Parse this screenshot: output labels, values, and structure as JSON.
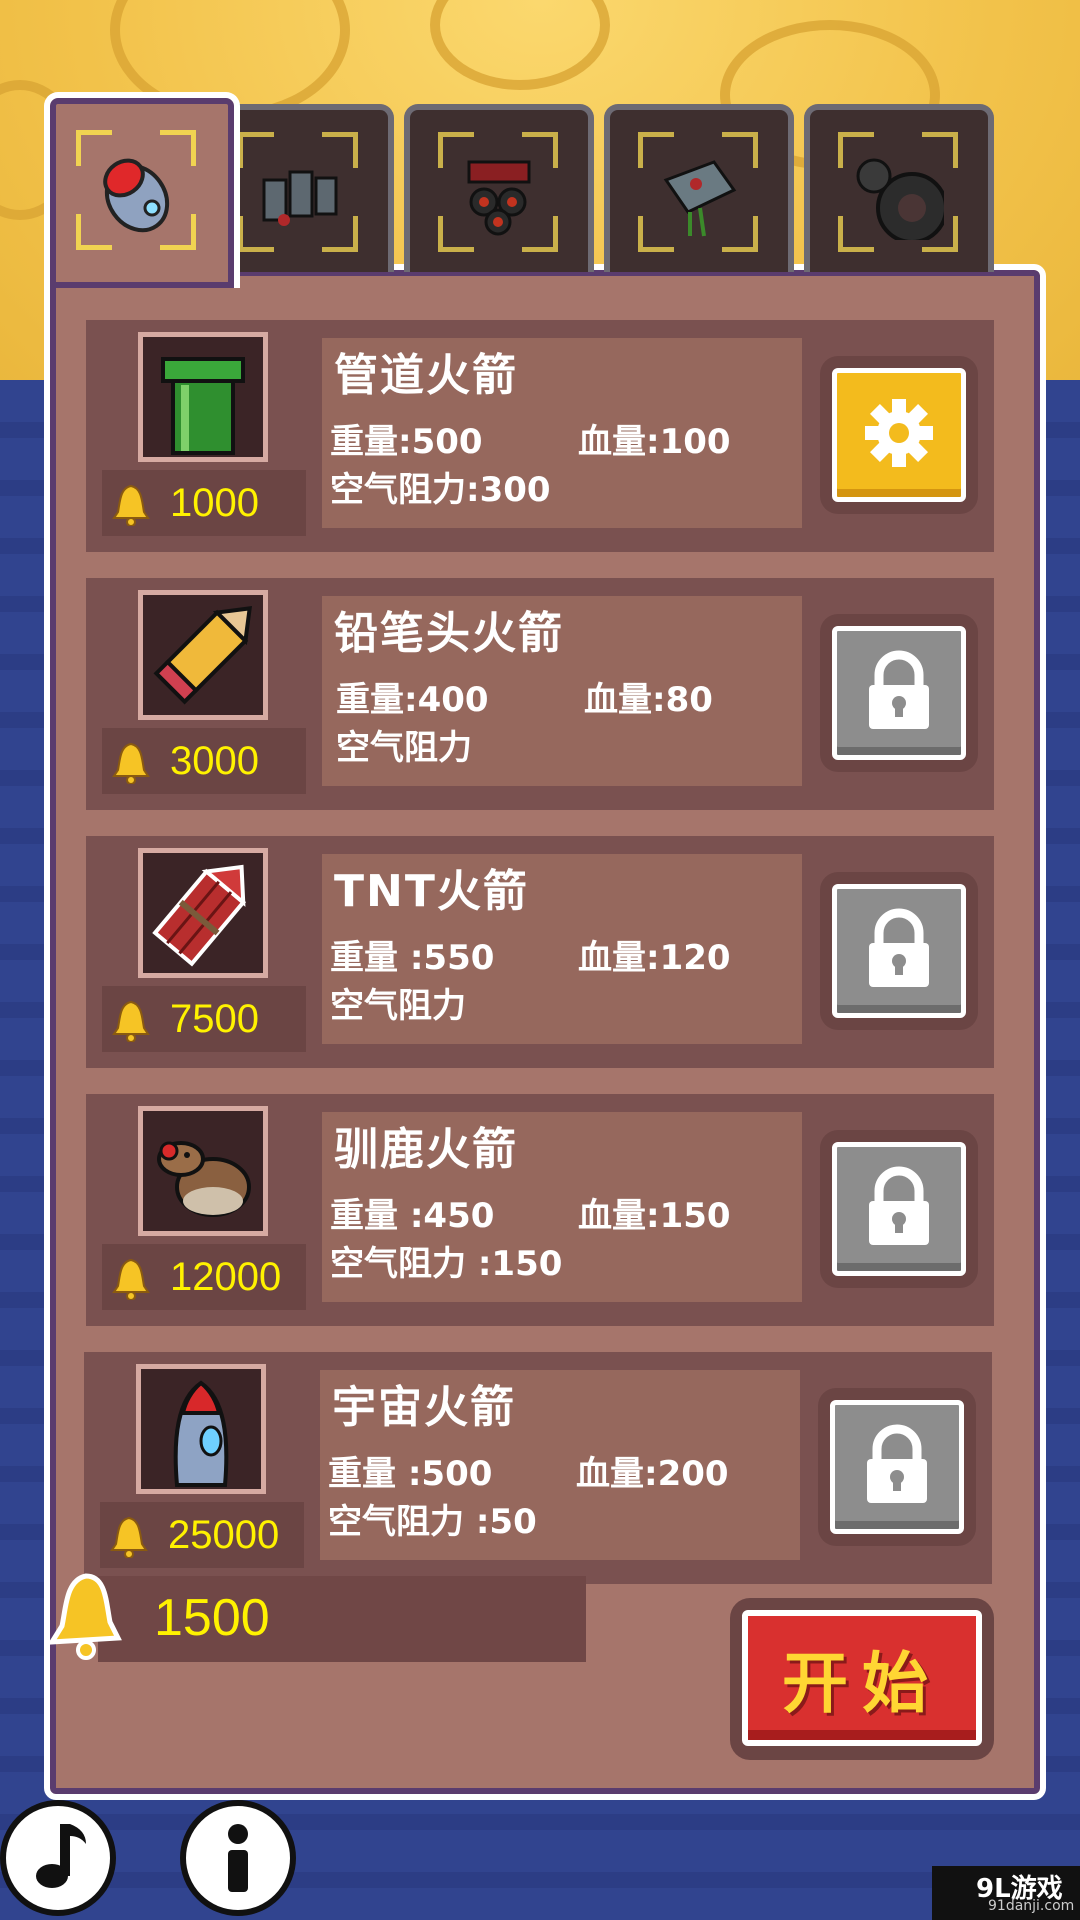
{
  "tabs": [
    {
      "name": "tab-rocket",
      "icon": "rocket-icon",
      "active": true
    },
    {
      "name": "tab-engine",
      "icon": "engine-icon",
      "active": false
    },
    {
      "name": "tab-thruster",
      "icon": "thruster-icon",
      "active": false
    },
    {
      "name": "tab-launcher",
      "icon": "launcher-icon",
      "active": false
    },
    {
      "name": "tab-gear",
      "icon": "cogwheel-icon",
      "active": false
    }
  ],
  "rockets": [
    {
      "name": "管道火箭",
      "weight": "重量:500",
      "hp": "血量:100",
      "drag": "空气阻力:300",
      "price": "1000",
      "icon": "pipe-rocket-icon",
      "action": "gear-icon"
    },
    {
      "name": "铅笔头火箭",
      "weight": "重量:400",
      "hp": "血量:80",
      "drag": "空气阻力",
      "price": "3000",
      "icon": "pencil-rocket-icon",
      "action": "lock-icon"
    },
    {
      "name": "TNT火箭",
      "weight": "重量 :550",
      "hp": "血量:120",
      "drag": "空气阻力",
      "price": "7500",
      "icon": "tnt-rocket-icon",
      "action": "lock-icon"
    },
    {
      "name": "驯鹿火箭",
      "weight": "重量 :450",
      "hp": "血量:150",
      "drag": "空气阻力 :150",
      "price": "12000",
      "icon": "reindeer-rocket-icon",
      "action": "lock-icon"
    },
    {
      "name": "宇宙火箭",
      "weight": "重量 :500",
      "hp": "血量:200",
      "drag": "空气阻力 :50",
      "price": "25000",
      "icon": "space-rocket-icon",
      "action": "lock-icon"
    }
  ],
  "coins": "1500",
  "start_label": "开始",
  "watermark": {
    "logo": "9L游戏",
    "url": "91danji.com"
  },
  "colors": {
    "price": "#fff200",
    "panel": "#a6756b",
    "start": "#d9302f",
    "gear_button": "#f3bb1d"
  }
}
